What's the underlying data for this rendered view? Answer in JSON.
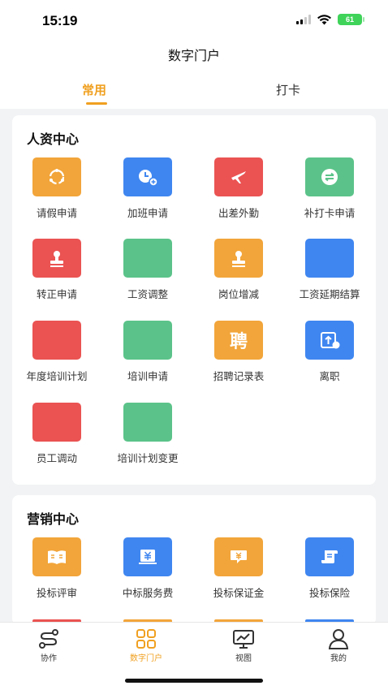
{
  "status_bar": {
    "time": "15:19",
    "battery": "61"
  },
  "header": {
    "title": "数字门户"
  },
  "tabs": [
    {
      "label": "常用",
      "active": true
    },
    {
      "label": "打卡",
      "active": false
    }
  ],
  "hr_center": {
    "title": "人资中心",
    "items": [
      {
        "label": "请假申请",
        "color": "#f2a53a",
        "icon": "refresh-circle-icon"
      },
      {
        "label": "加班申请",
        "color": "#3f86f0",
        "icon": "clock-plus-icon"
      },
      {
        "label": "出差外勤",
        "color": "#ea5352",
        "icon": "airplane-icon"
      },
      {
        "label": "补打卡申请",
        "color": "#5bc389",
        "icon": "swap-arrows-icon"
      },
      {
        "label": "转正申请",
        "color": "#ea5352",
        "icon": "stamp-icon"
      },
      {
        "label": "工资调整",
        "color": "#5bc389",
        "icon": "blank-icon"
      },
      {
        "label": "岗位增减",
        "color": "#f2a53a",
        "icon": "stamp-icon"
      },
      {
        "label": "工资延期结算",
        "color": "#3f86f0",
        "icon": "blank-icon"
      },
      {
        "label": "年度培训计划",
        "color": "#ea5352",
        "icon": "blank-icon"
      },
      {
        "label": "培训申请",
        "color": "#5bc389",
        "icon": "blank-icon"
      },
      {
        "label": "招聘记录表",
        "color": "#f2a53a",
        "icon": "pin-character-icon",
        "glyph": "聘"
      },
      {
        "label": "离职",
        "color": "#3f86f0",
        "icon": "exit-icon"
      },
      {
        "label": "员工调动",
        "color": "#ea5352",
        "icon": "blank-icon"
      },
      {
        "label": "培训计划变更",
        "color": "#5bc389",
        "icon": "blank-icon"
      }
    ]
  },
  "marketing_center": {
    "title": "营销中心",
    "items": [
      {
        "label": "投标评审",
        "color": "#f2a53a",
        "icon": "open-book-icon"
      },
      {
        "label": "中标服务费",
        "color": "#3f86f0",
        "icon": "yen-document-icon"
      },
      {
        "label": "投标保证金",
        "color": "#f2a53a",
        "icon": "yen-chat-icon"
      },
      {
        "label": "投标保险",
        "color": "#3f86f0",
        "icon": "scroll-icon"
      }
    ]
  },
  "bottom_nav": [
    {
      "label": "协作",
      "icon": "collaboration-icon",
      "active": false
    },
    {
      "label": "数字门户",
      "icon": "grid-icon",
      "active": true
    },
    {
      "label": "视图",
      "icon": "monitor-chart-icon",
      "active": false
    },
    {
      "label": "我的",
      "icon": "user-icon",
      "active": false
    }
  ]
}
